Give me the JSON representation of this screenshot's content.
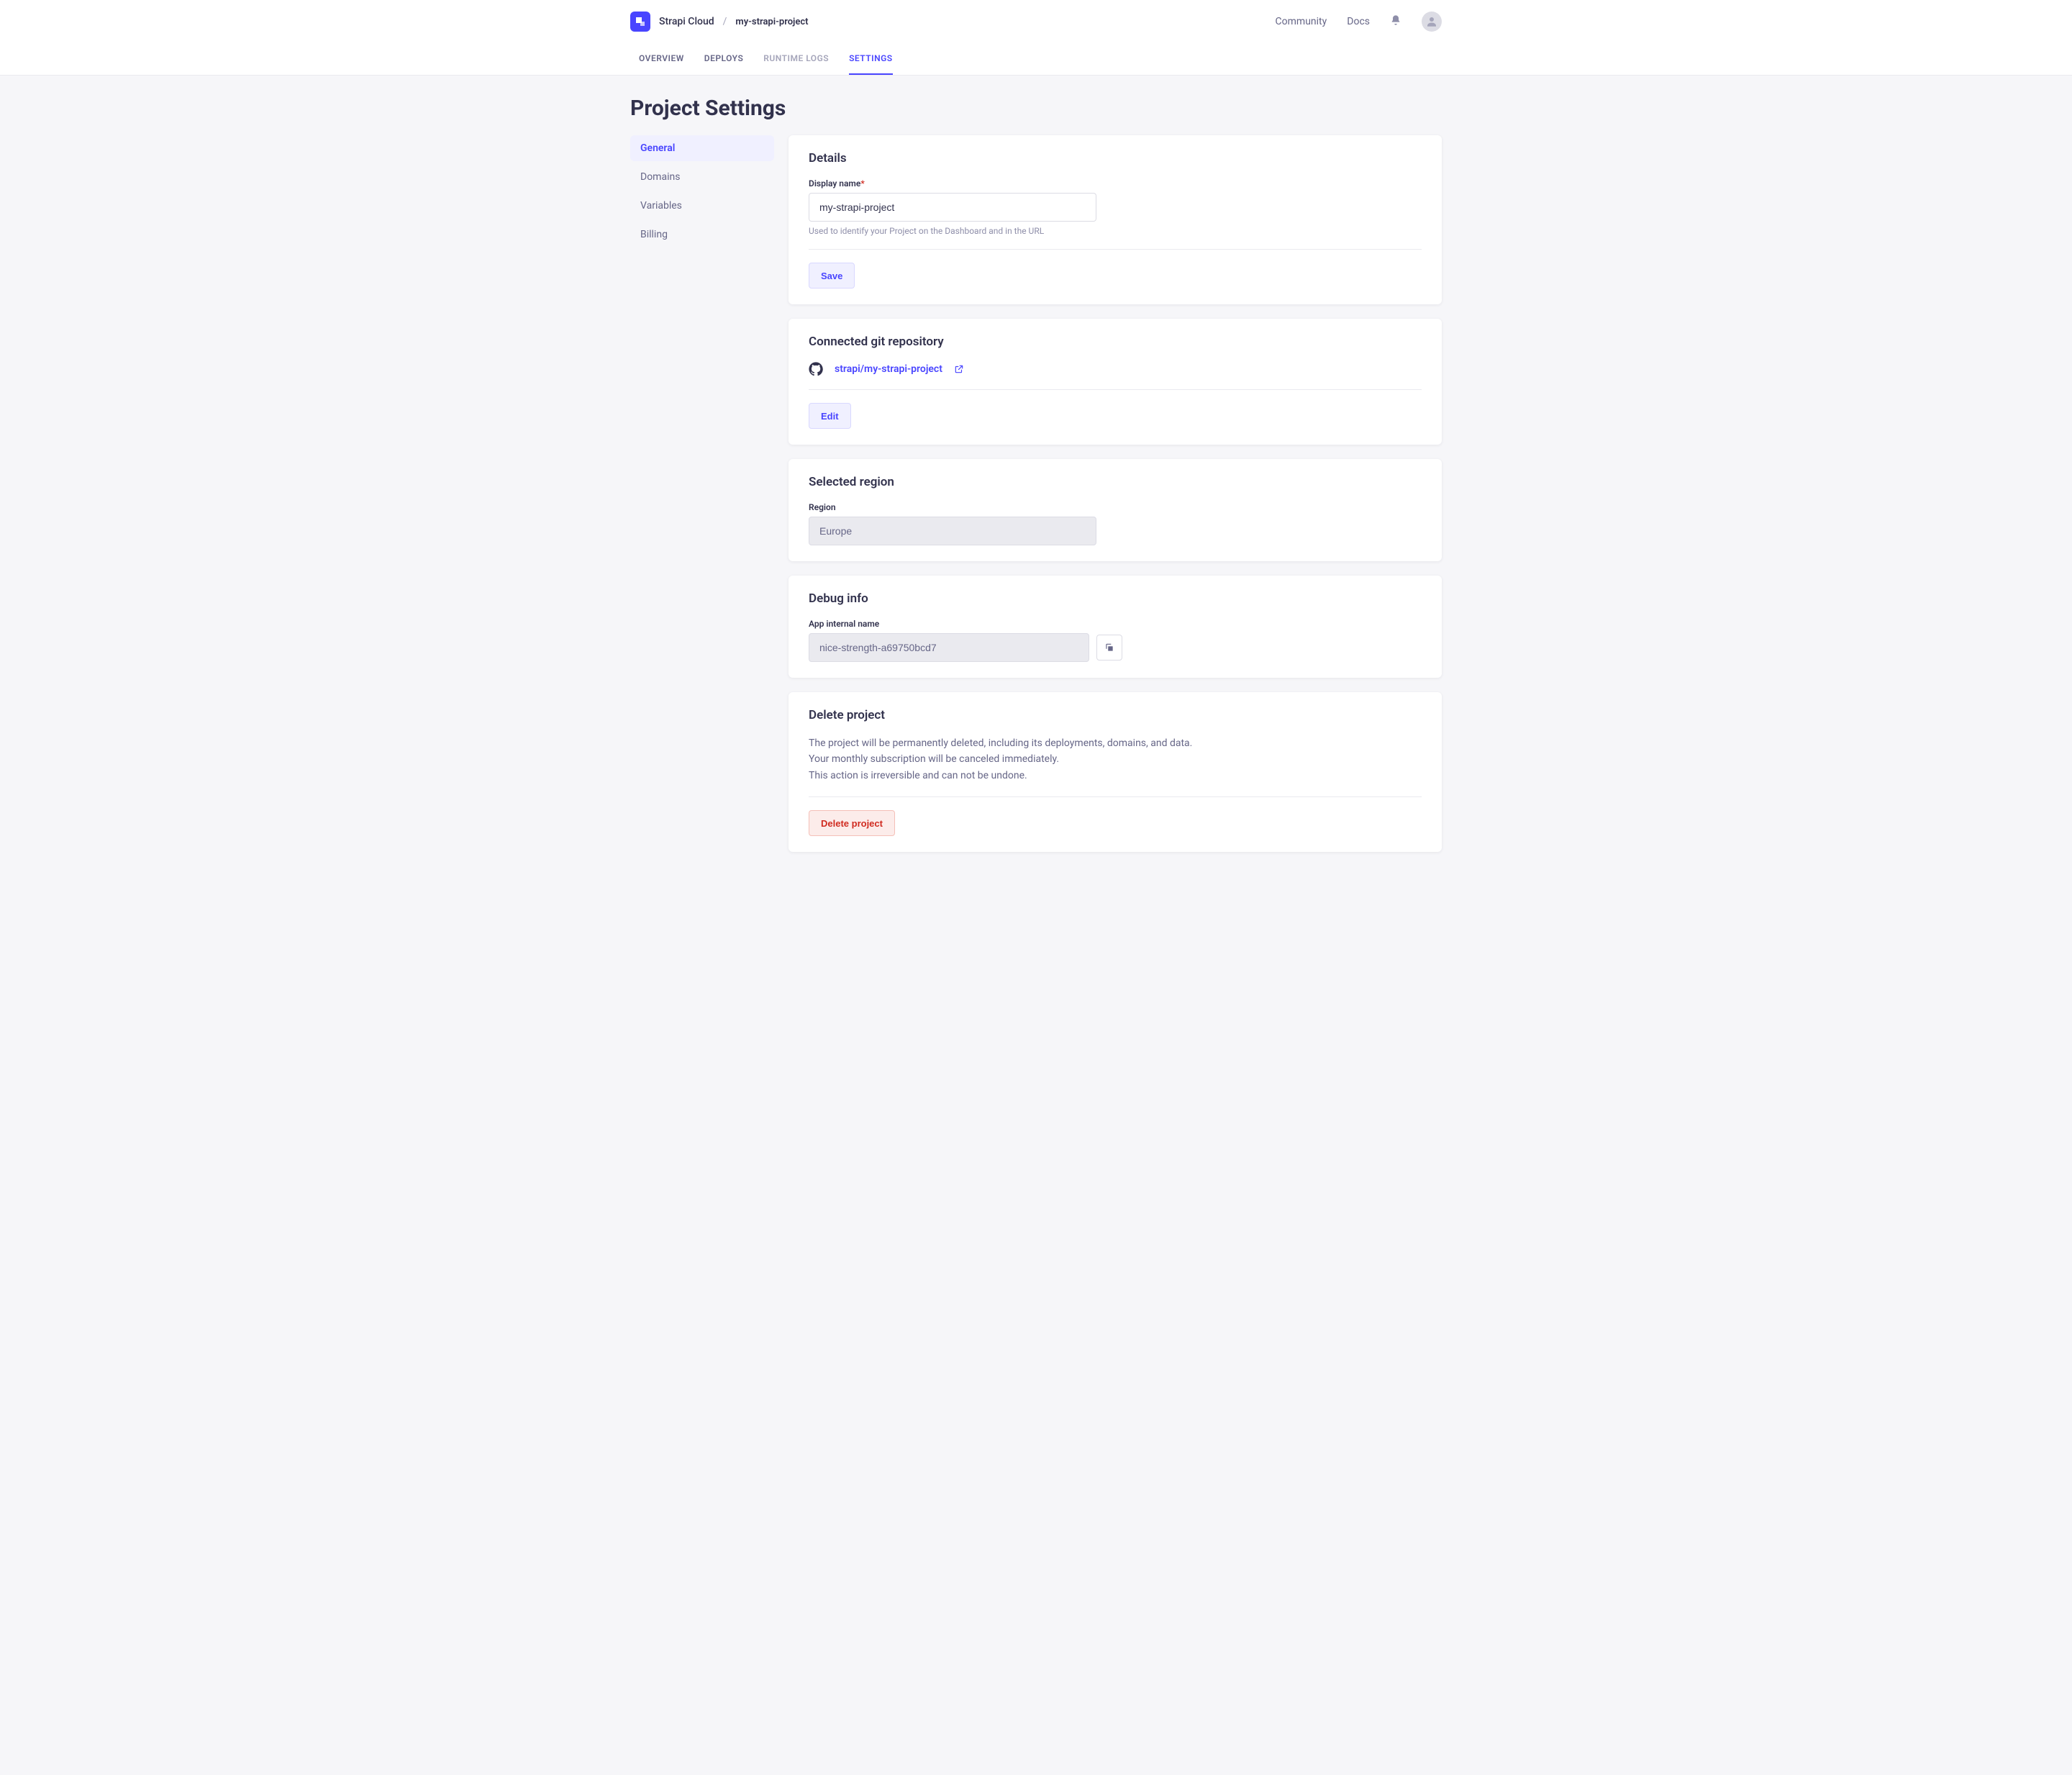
{
  "header": {
    "brand": "Strapi Cloud",
    "project": "my-strapi-project",
    "links": {
      "community": "Community",
      "docs": "Docs"
    }
  },
  "tabs": {
    "overview": "Overview",
    "deploys": "Deploys",
    "runtime_logs": "Runtime Logs",
    "settings": "Settings"
  },
  "page": {
    "title": "Project Settings"
  },
  "sidebar": {
    "general": "General",
    "domains": "Domains",
    "variables": "Variables",
    "billing": "Billing"
  },
  "details": {
    "title": "Details",
    "display_name_label": "Display name",
    "display_name_value": "my-strapi-project",
    "hint": "Used to identify your Project on the Dashboard and in the URL",
    "save": "Save"
  },
  "repo": {
    "title": "Connected git repository",
    "link_text": "strapi/my-strapi-project",
    "edit": "Edit"
  },
  "region": {
    "title": "Selected region",
    "label": "Region",
    "value": "Europe"
  },
  "debug": {
    "title": "Debug info",
    "label": "App internal name",
    "value": "nice-strength-a69750bcd7"
  },
  "delete": {
    "title": "Delete project",
    "line1": "The project will be permanently deleted, including its deployments, domains, and data.",
    "line2": "Your monthly subscription will be canceled immediately.",
    "line3": "This action is irreversible and can not be undone.",
    "button": "Delete project"
  }
}
